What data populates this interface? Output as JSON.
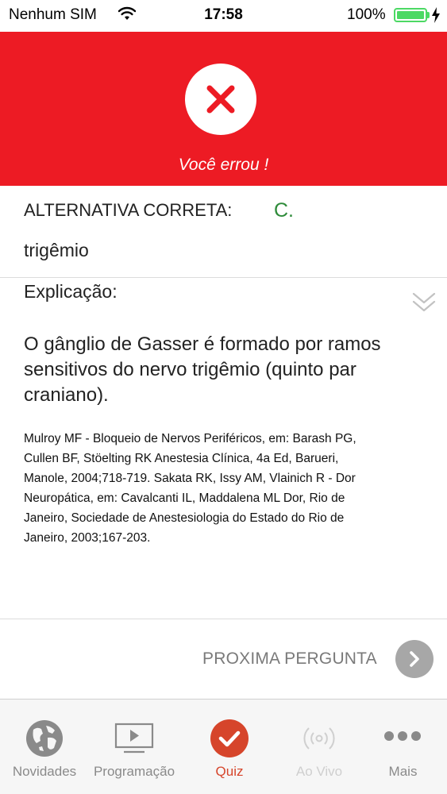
{
  "status_bar": {
    "carrier": "Nenhum SIM",
    "time": "17:58",
    "battery": "100%"
  },
  "result": {
    "icon": "close-icon",
    "message": "Você errou !",
    "color": "#ed1b24"
  },
  "correct_answer": {
    "label": "ALTERNATIVA CORRETA:",
    "letter": "C.",
    "text": "trigêmio",
    "letter_color": "#2e8b3a"
  },
  "explanation": {
    "label": "Explicação:",
    "expand_icon": "double-chevron-down-icon",
    "text": "O gânglio de Gasser é formado por ramos sensitivos do nervo trigêmio (quinto par craniano).",
    "reference_lines": [
      "Mulroy MF - Bloqueio de Nervos Periféricos, em: Barash PG,",
      "Cullen BF, Stöelting RK  Anestesia Clínica, 4a Ed, Barueri,",
      "Manole, 2004;718-719. Sakata RK, Issy AM, Vlainich R - Dor",
      "Neuropática, em: Cavalcanti IL, Maddalena ML  Dor, Rio de",
      "Janeiro, Sociedade de Anestesiologia do Estado do Rio de",
      "Janeiro, 2003;167-203."
    ]
  },
  "next": {
    "label": "PROXIMA PERGUNTA",
    "icon": "chevron-right-icon"
  },
  "tab_bar": {
    "active_color": "#d6452b",
    "tabs": [
      {
        "label": "Novidades",
        "icon": "globe-icon",
        "state": "normal"
      },
      {
        "label": "Programação",
        "icon": "tv-play-icon",
        "state": "normal"
      },
      {
        "label": "Quiz",
        "icon": "check-circle-icon",
        "state": "active"
      },
      {
        "label": "Ao Vivo",
        "icon": "broadcast-icon",
        "state": "disabled"
      },
      {
        "label": "Mais",
        "icon": "more-dots-icon",
        "state": "normal"
      }
    ]
  }
}
